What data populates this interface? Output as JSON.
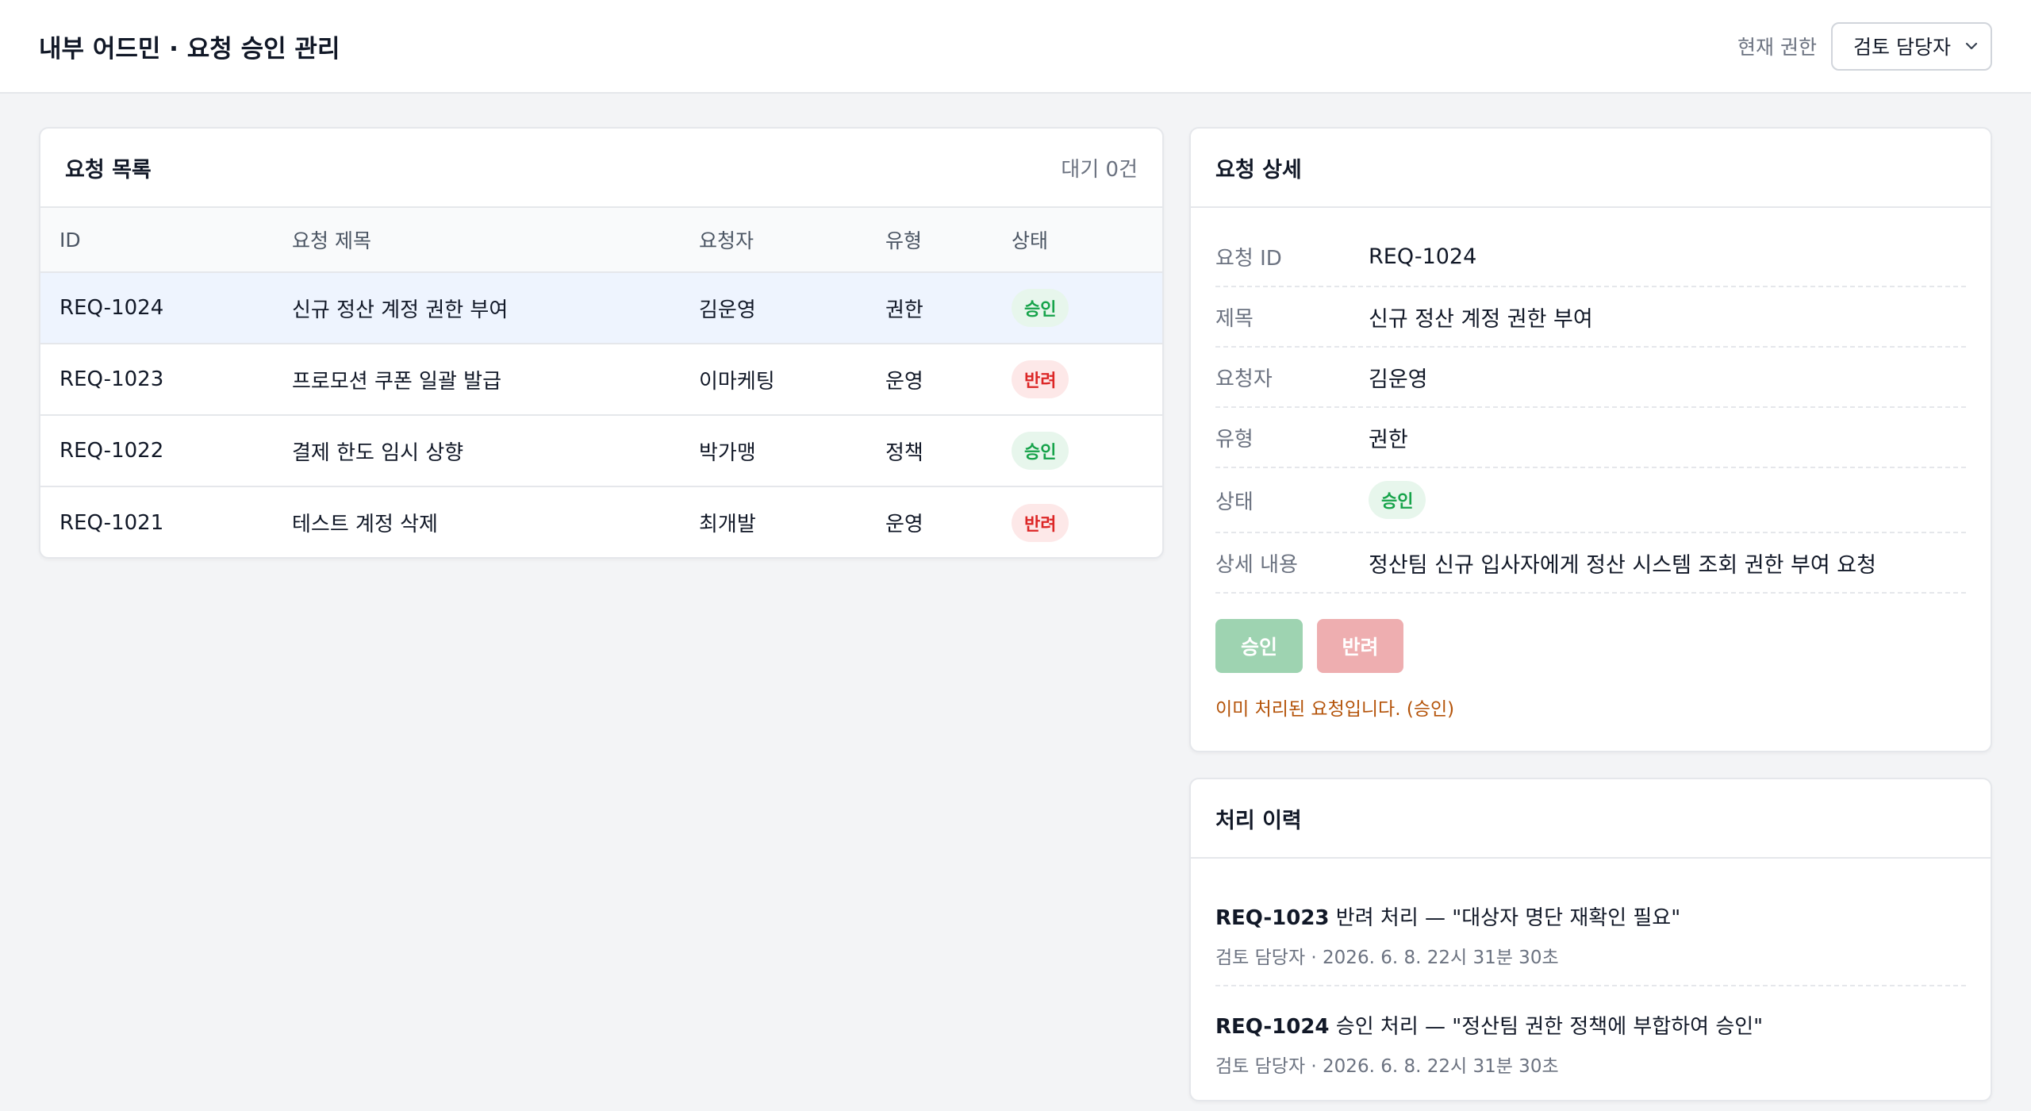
{
  "header": {
    "title": "내부 어드민 · 요청 승인 관리",
    "role_label": "현재 권한",
    "role_value": "검토 담당자",
    "role_icon": "chevron-down-icon"
  },
  "list": {
    "title": "요청 목록",
    "pending": "대기 0건",
    "columns": [
      "ID",
      "요청 제목",
      "요청자",
      "유형",
      "상태"
    ],
    "rows": [
      {
        "id": "REQ-1024",
        "title": "신규 정산 계정 권한 부여",
        "requester": "김운영",
        "type": "권한",
        "status": "승인"
      },
      {
        "id": "REQ-1023",
        "title": "프로모션 쿠폰 일괄 발급",
        "requester": "이마케팅",
        "type": "운영",
        "status": "반려"
      },
      {
        "id": "REQ-1022",
        "title": "결제 한도 임시 상향",
        "requester": "박가맹",
        "type": "정책",
        "status": "승인"
      },
      {
        "id": "REQ-1021",
        "title": "테스트 계정 삭제",
        "requester": "최개발",
        "type": "운영",
        "status": "반려"
      }
    ]
  },
  "detail": {
    "title": "요청 상세",
    "fields": [
      {
        "label": "요청 ID",
        "value": "REQ-1024"
      },
      {
        "label": "제목",
        "value": "신규 정산 계정 권한 부여"
      },
      {
        "label": "요청자",
        "value": "김운영"
      },
      {
        "label": "유형",
        "value": "권한"
      },
      {
        "label": "상태",
        "value": "승인"
      },
      {
        "label": "상세 내용",
        "value": "정산팀 신규 입사자에게 정산 시스템 조회 권한 부여 요청"
      }
    ],
    "approve_label": "승인",
    "reject_label": "반려",
    "notice": "이미 처리된 요청입니다. (승인)"
  },
  "history": {
    "title": "처리 이력",
    "items": [
      {
        "id": "REQ-1023",
        "text": " 반려 처리 — \"대상자 명단 재확인 필요\"",
        "meta": "검토 담당자 · 2026. 6. 8. 22시 31분 30초"
      },
      {
        "id": "REQ-1024",
        "text": " 승인 처리 — \"정산팀 권한 정책에 부합하여 승인\"",
        "meta": "검토 담당자 · 2026. 6. 8. 22시 31분 30초"
      }
    ]
  },
  "colors": {
    "approve": "#16a34a",
    "reject": "#dc2626",
    "selected_row": "#eef4fe",
    "notice": "#b45309"
  }
}
